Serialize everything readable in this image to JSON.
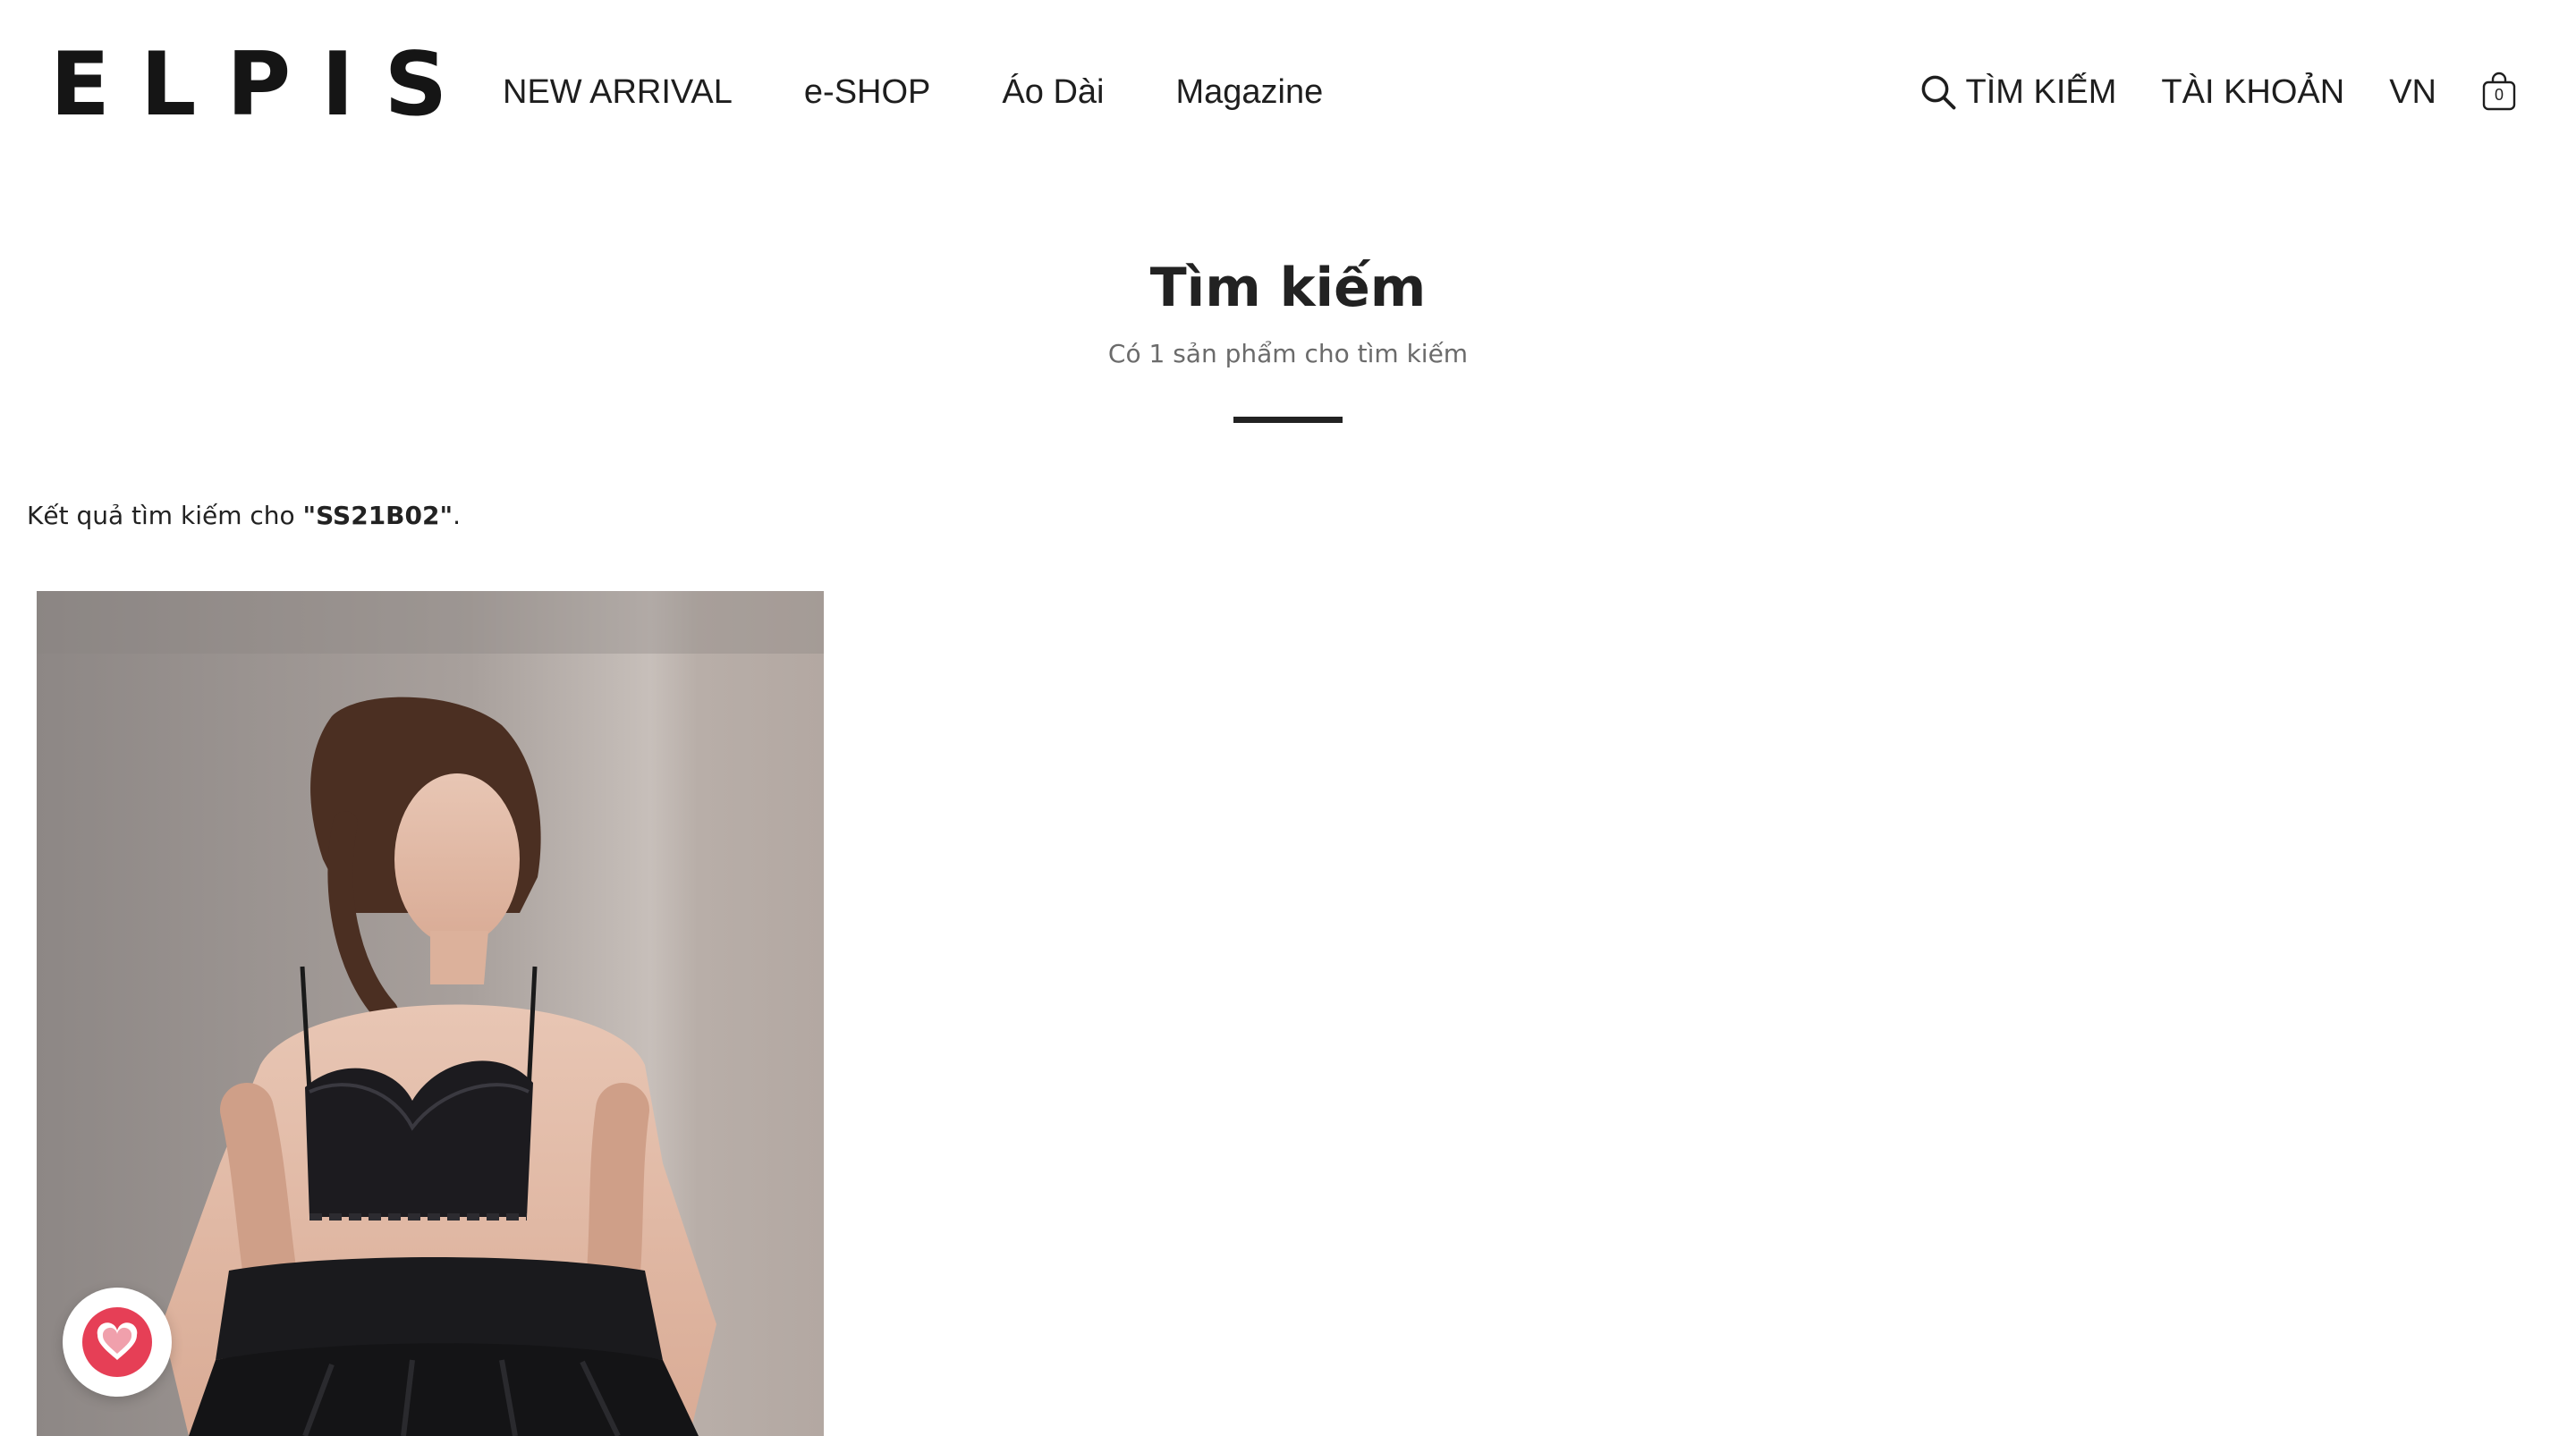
{
  "header": {
    "logo": "ELPIS",
    "nav": [
      "NEW ARRIVAL",
      "e-SHOP",
      "Áo Dài",
      "Magazine"
    ],
    "search_label": "TÌM KIẾM",
    "account_label": "TÀI KHOẢN",
    "language": "VN",
    "cart_count": "0"
  },
  "main": {
    "title": "Tìm kiếm",
    "subtitle": "Có 1 sản phẩm cho tìm kiếm",
    "result_prefix": "Kết quả tìm kiếm cho ",
    "query": "\"SS21B02\"",
    "result_suffix": "."
  },
  "product": {
    "image_icon": "product-photo"
  },
  "wishlist": {
    "icon": "heart-icon",
    "color": "#e63f56"
  },
  "colors": {
    "text": "#1e1e1e",
    "muted": "#6b6b6b",
    "accent": "#e63f56"
  }
}
